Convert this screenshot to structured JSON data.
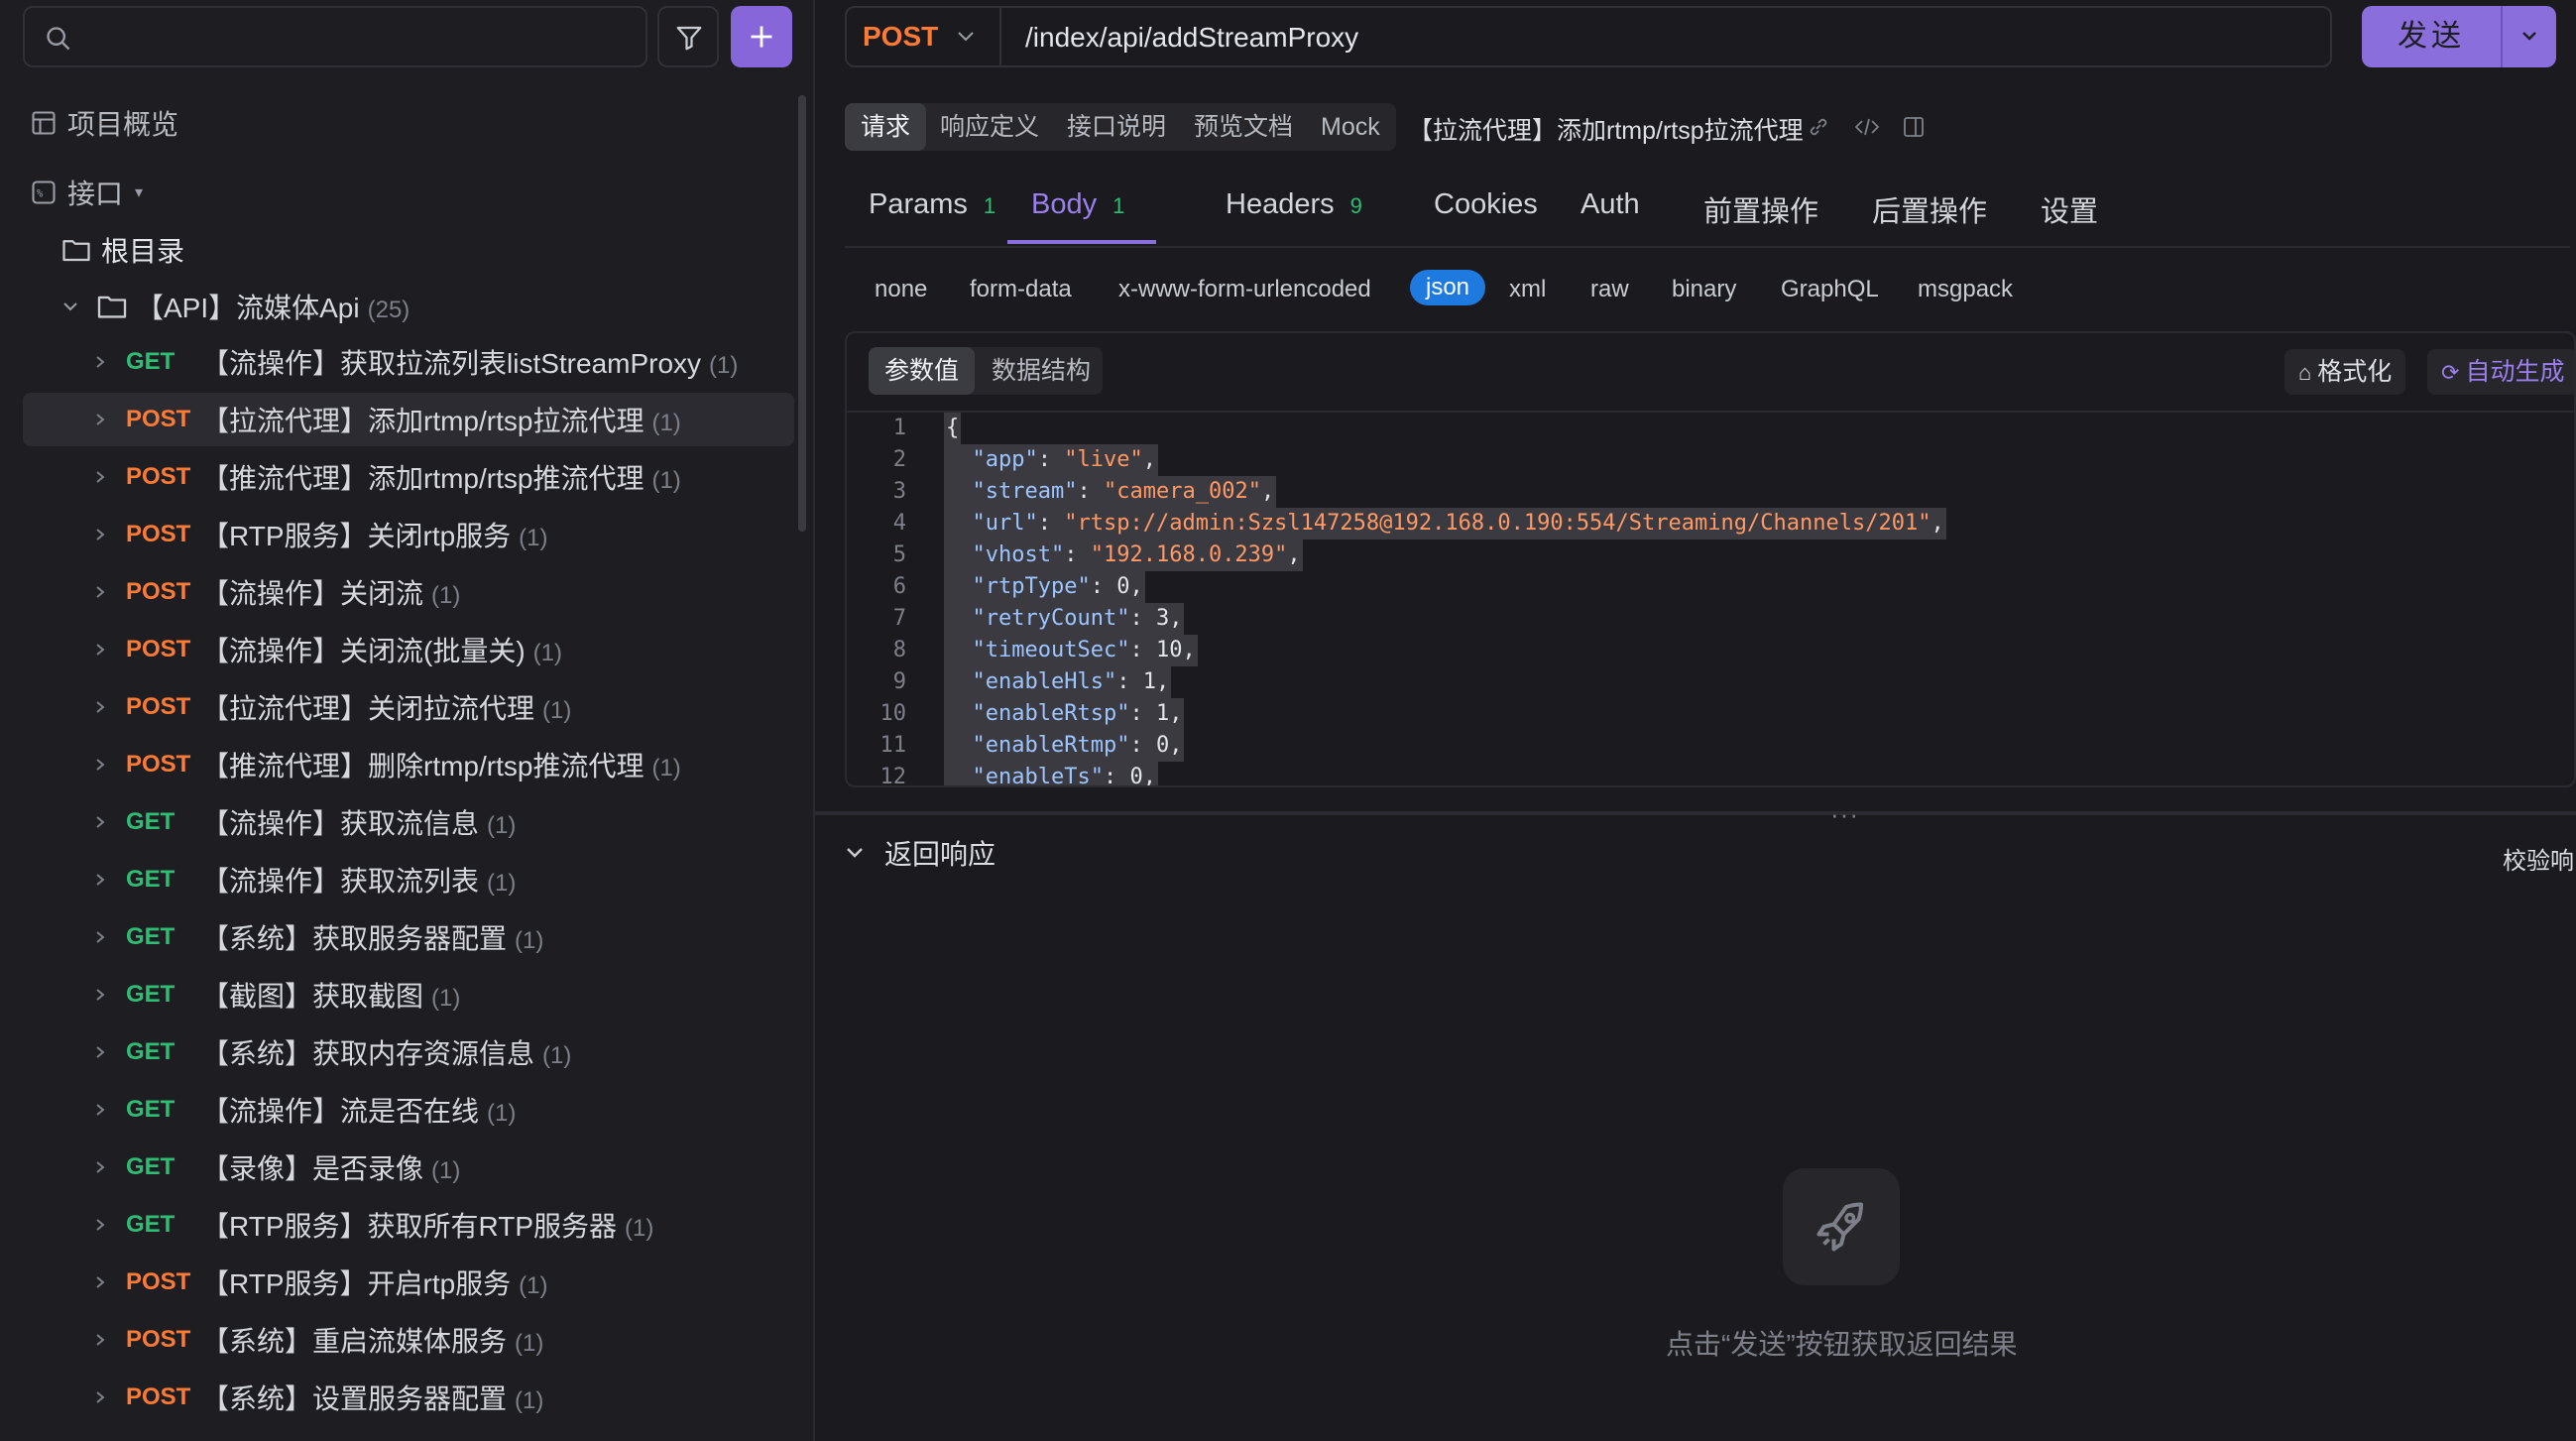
{
  "sidebar": {
    "search_placeholder": "",
    "overview_label": "项目概览",
    "api_label": "接口",
    "root_label": "根目录",
    "folder": {
      "name": "【API】流媒体Api",
      "count": "(25)"
    },
    "items": [
      {
        "method": "GET",
        "title": "【流操作】获取拉流列表listStreamProxy",
        "count": "(1)"
      },
      {
        "method": "POST",
        "title": "【拉流代理】添加rtmp/rtsp拉流代理",
        "count": "(1)",
        "selected": true
      },
      {
        "method": "POST",
        "title": "【推流代理】添加rtmp/rtsp推流代理",
        "count": "(1)"
      },
      {
        "method": "POST",
        "title": "【RTP服务】关闭rtp服务",
        "count": "(1)"
      },
      {
        "method": "POST",
        "title": "【流操作】关闭流",
        "count": "(1)"
      },
      {
        "method": "POST",
        "title": "【流操作】关闭流(批量关)",
        "count": "(1)"
      },
      {
        "method": "POST",
        "title": "【拉流代理】关闭拉流代理",
        "count": "(1)"
      },
      {
        "method": "POST",
        "title": "【推流代理】删除rtmp/rtsp推流代理",
        "count": "(1)"
      },
      {
        "method": "GET",
        "title": "【流操作】获取流信息",
        "count": "(1)"
      },
      {
        "method": "GET",
        "title": "【流操作】获取流列表",
        "count": "(1)"
      },
      {
        "method": "GET",
        "title": "【系统】获取服务器配置",
        "count": "(1)"
      },
      {
        "method": "GET",
        "title": "【截图】获取截图",
        "count": "(1)"
      },
      {
        "method": "GET",
        "title": "【系统】获取内存资源信息",
        "count": "(1)"
      },
      {
        "method": "GET",
        "title": "【流操作】流是否在线",
        "count": "(1)"
      },
      {
        "method": "GET",
        "title": "【录像】是否录像",
        "count": "(1)"
      },
      {
        "method": "GET",
        "title": "【RTP服务】获取所有RTP服务器",
        "count": "(1)"
      },
      {
        "method": "POST",
        "title": "【RTP服务】开启rtp服务",
        "count": "(1)"
      },
      {
        "method": "POST",
        "title": "【系统】重启流媒体服务",
        "count": "(1)"
      },
      {
        "method": "POST",
        "title": "【系统】设置服务器配置",
        "count": "(1)"
      }
    ]
  },
  "request": {
    "method": "POST",
    "url": "/index/api/addStreamProxy",
    "send_label": "发送"
  },
  "subtabs": [
    "请求",
    "响应定义",
    "接口说明",
    "预览文档",
    "Mock"
  ],
  "request_title": "【拉流代理】添加rtmp/rtsp拉流代理",
  "body_tabs": [
    {
      "label": "Params",
      "count": "1"
    },
    {
      "label": "Body",
      "count": "1",
      "active": true
    },
    {
      "label": "Headers",
      "count": "9"
    },
    {
      "label": "Cookies",
      "count": ""
    },
    {
      "label": "Auth",
      "count": ""
    },
    {
      "label": "前置操作",
      "count": ""
    },
    {
      "label": "后置操作",
      "count": ""
    },
    {
      "label": "设置",
      "count": ""
    }
  ],
  "content_types": [
    "none",
    "form-data",
    "x-www-form-urlencoded",
    "json",
    "xml",
    "raw",
    "binary",
    "GraphQL",
    "msgpack"
  ],
  "editor": {
    "tabs": [
      "参数值",
      "数据结构"
    ],
    "format_label": "格式化",
    "auto_label": "自动生成",
    "lines": [
      {
        "n": "1",
        "key": "",
        "val": "{",
        "type": "brace"
      },
      {
        "n": "2",
        "key": "app",
        "val": "live",
        "type": "str"
      },
      {
        "n": "3",
        "key": "stream",
        "val": "camera_002",
        "type": "str"
      },
      {
        "n": "4",
        "key": "url",
        "val": "rtsp://admin:Szsl147258@192.168.0.190:554/Streaming/Channels/201",
        "type": "str"
      },
      {
        "n": "5",
        "key": "vhost",
        "val": "192.168.0.239",
        "type": "str"
      },
      {
        "n": "6",
        "key": "rtpType",
        "val": "0",
        "type": "num"
      },
      {
        "n": "7",
        "key": "retryCount",
        "val": "3",
        "type": "num"
      },
      {
        "n": "8",
        "key": "timeoutSec",
        "val": "10",
        "type": "num"
      },
      {
        "n": "9",
        "key": "enableHls",
        "val": "1",
        "type": "num"
      },
      {
        "n": "10",
        "key": "enableRtsp",
        "val": "1",
        "type": "num"
      },
      {
        "n": "11",
        "key": "enableRtmp",
        "val": "0",
        "type": "num"
      },
      {
        "n": "12",
        "key": "enableTs",
        "val": "0",
        "type": "num"
      }
    ]
  },
  "response": {
    "title": "返回响应",
    "validate_label": "校验响",
    "empty_hint": "点击“发送”按钮获取返回结果"
  }
}
